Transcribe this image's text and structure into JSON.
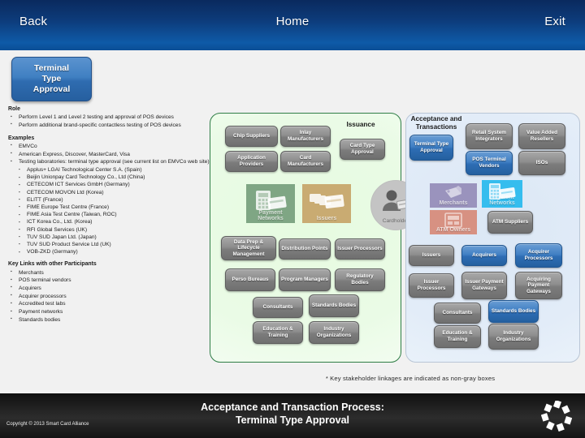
{
  "nav": {
    "back": "Back",
    "home": "Home",
    "exit": "Exit"
  },
  "title_chip": {
    "line1": "Terminal",
    "line2": "Type",
    "line3": "Approval"
  },
  "left_panel": {
    "role_heading": "Role",
    "role_items": [
      "Perform Level 1 and Level 2 testing and approval of POS devices",
      "Perform additional brand-specific contactless testing of POS devices"
    ],
    "examples_heading": "Examples",
    "examples_items": [
      "EMVCo",
      "American Express, Discover, MasterCard, Visa",
      "Testing laboratories: terminal type approval (see current list on EMVCo web site)"
    ],
    "labs": [
      "Applus+ LGAI Technological Center S.A. (Spain)",
      "Beijin Unionpay Card Technology Co., Ltd (China)",
      "CETECOM ICT Services GmbH (Germany)",
      "CETECOM MOVON Ltd (Korea)",
      "ELITT (France)",
      "FIME Europe Test Centre (France)",
      "FIME Asia Test Centre (Taiwan, ROC)",
      "ICT Korea Co., Ltd. (Korea)",
      "RFI Global Services (UK)",
      "TUV SUD Japan Ltd. (Japan)",
      "TUV SUD Product Service Ltd (UK)",
      "VOB-ZKD (Germany)"
    ],
    "links_heading": "Key Links with other Participants",
    "links_items": [
      "Merchants",
      "POS terminal vendors",
      "Acquirers",
      "Acquirer processors",
      "Accredited test labs",
      "Payment networks",
      "Standards bodies"
    ]
  },
  "diagram": {
    "issuance_caption": "Issuance",
    "acceptance_caption_line1": "Acceptance and",
    "acceptance_caption_line2": "Transactions",
    "accent_color": "#2e6db4",
    "gray_color": "#7c7c7c",
    "issuance_nodes": [
      {
        "label": "Chip Suppliers",
        "style": "gray"
      },
      {
        "label": "Inlay Manufacturers",
        "style": "gray"
      },
      {
        "label": "Card Type Approval",
        "style": "gray"
      },
      {
        "label": "Application Providers",
        "style": "gray"
      },
      {
        "label": "Card Manufacturers",
        "style": "gray"
      },
      {
        "label": "Data Prep & Lifecycle Management",
        "style": "gray"
      },
      {
        "label": "Distribution Points",
        "style": "gray"
      },
      {
        "label": "Issuer Processors",
        "style": "gray"
      },
      {
        "label": "Perso Bureaus",
        "style": "gray"
      },
      {
        "label": "Program Managers",
        "style": "gray"
      },
      {
        "label": "Regulatory Bodies",
        "style": "gray"
      },
      {
        "label": "Consultants",
        "style": "gray"
      },
      {
        "label": "Standards Bodies",
        "style": "gray"
      },
      {
        "label": "Education & Training",
        "style": "gray"
      },
      {
        "label": "Industry Organizations",
        "style": "gray"
      }
    ],
    "acceptance_nodes": [
      {
        "label": "Retail System Integrators",
        "style": "gray"
      },
      {
        "label": "Value Added Resellers",
        "style": "gray"
      },
      {
        "label": "Terminal Type Approval",
        "style": "blue"
      },
      {
        "label": "POS Terminal Vendors",
        "style": "blue"
      },
      {
        "label": "ISOs",
        "style": "gray"
      },
      {
        "label": "ATM Suppliers",
        "style": "gray"
      },
      {
        "label": "Issuers",
        "style": "gray"
      },
      {
        "label": "Acquirers",
        "style": "blue"
      },
      {
        "label": "Acquirer Processors",
        "style": "blue"
      },
      {
        "label": "Issuer Processors",
        "style": "gray"
      },
      {
        "label": "Issuer Payment Gateways",
        "style": "gray"
      },
      {
        "label": "Acquiring Payment Gateways",
        "style": "gray"
      },
      {
        "label": "Consultants",
        "style": "gray"
      },
      {
        "label": "Standards Bodies",
        "style": "blue"
      },
      {
        "label": "Education & Training",
        "style": "gray"
      },
      {
        "label": "Industry Organizations",
        "style": "gray"
      }
    ],
    "tiles": [
      {
        "label": "Payment Networks",
        "color": "#7fa684"
      },
      {
        "label": "Issuers",
        "color": "#c9ab72"
      },
      {
        "label": "Cardholder",
        "color": "#c4c4c4"
      },
      {
        "label": "Merchants",
        "color": "#9a93bd"
      },
      {
        "label": "Payment Networks",
        "color": "#35bdee"
      },
      {
        "label": "ATM Owners",
        "color": "#d79182"
      }
    ]
  },
  "footnote": "* Key stakeholder linkages are indicated as non-gray boxes",
  "footer": {
    "title_line1": "Acceptance and Transaction Process:",
    "title_line2": "Terminal Type Approval",
    "copyright": "Copyright © 2013 Smart Card Alliance"
  }
}
